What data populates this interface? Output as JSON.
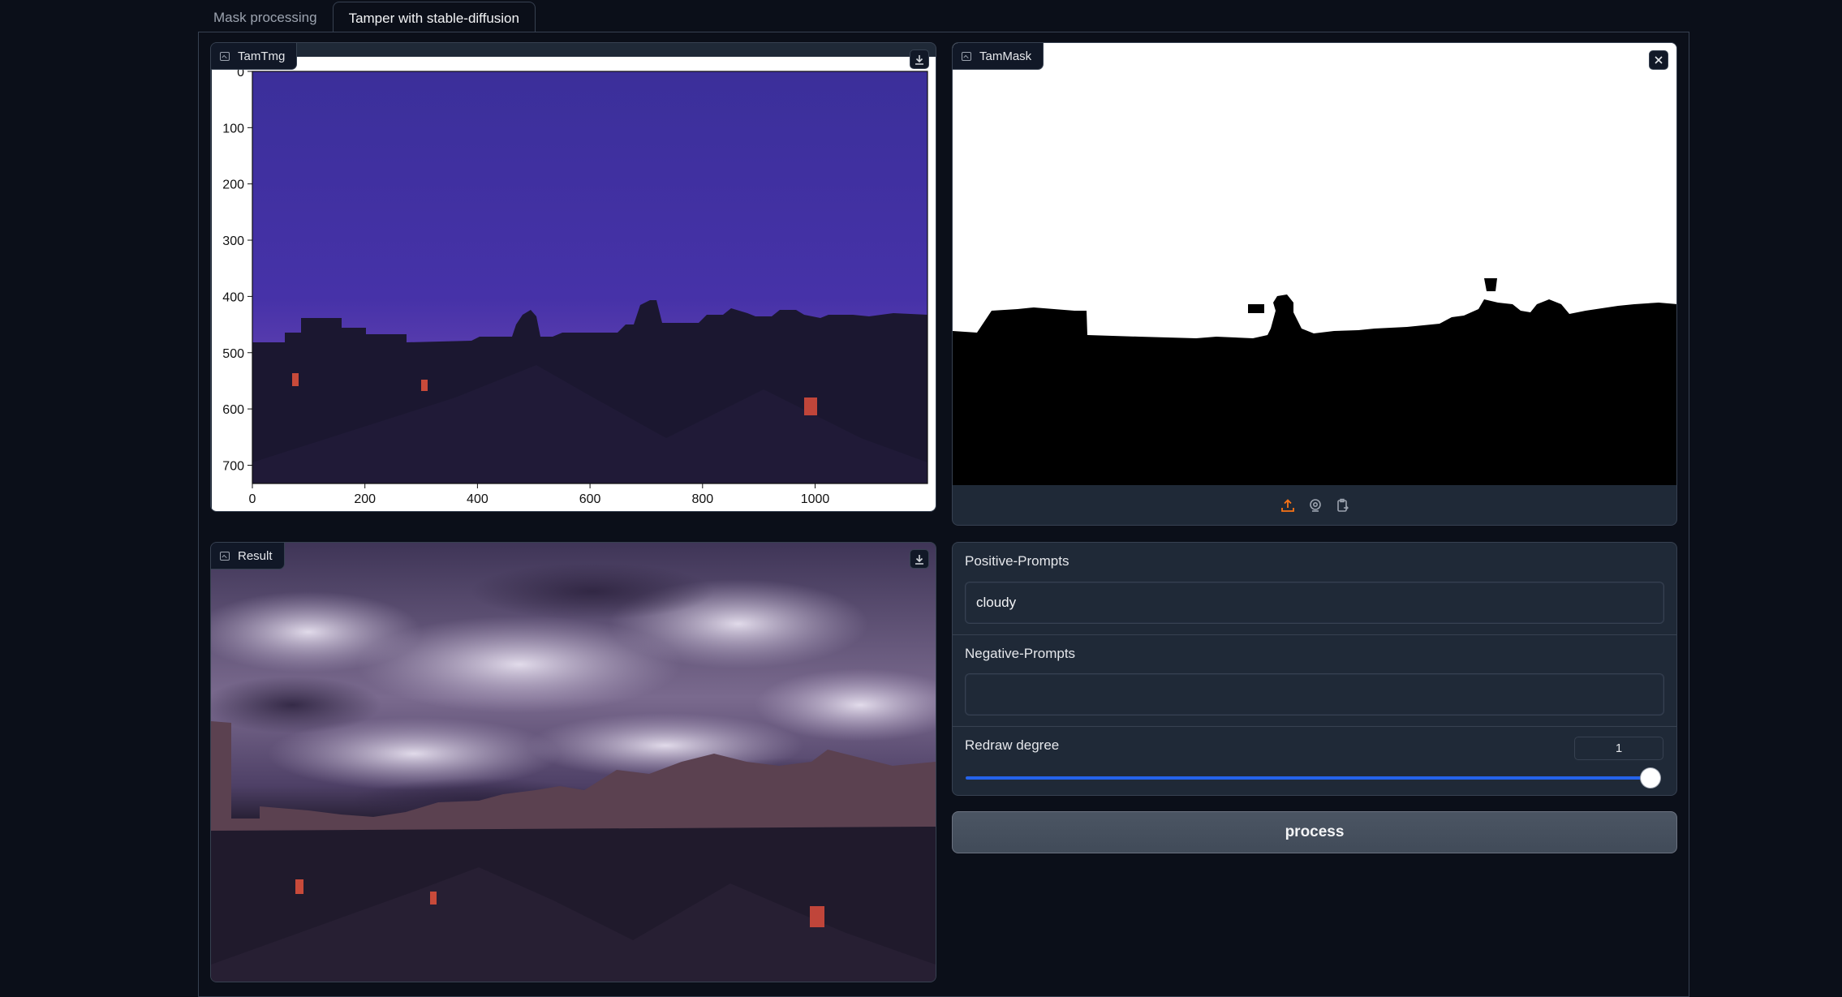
{
  "tabs": [
    {
      "label": "Mask processing",
      "active": false
    },
    {
      "label": "Tamper with stable-diffusion",
      "active": true
    }
  ],
  "tam_image": {
    "label": "TamTmg",
    "plot": {
      "x_ticks": [
        "0",
        "200",
        "400",
        "600",
        "800",
        "1000"
      ],
      "y_ticks": [
        "0",
        "100",
        "200",
        "300",
        "400",
        "500",
        "600",
        "700"
      ]
    }
  },
  "tam_mask": {
    "label": "TamMask",
    "toolbar": [
      "upload-icon",
      "webcam-icon",
      "clipboard-icon"
    ]
  },
  "result": {
    "label": "Result"
  },
  "form": {
    "positive_label": "Positive-Prompts",
    "positive_value": "cloudy",
    "negative_label": "Negative-Prompts",
    "negative_value": "",
    "redraw_label": "Redraw degree",
    "redraw_value": "1",
    "redraw_level": 1.0
  },
  "process_button": "process",
  "colors": {
    "background": "#0b0f19",
    "panel": "#1f2937",
    "border": "#374151",
    "slider_accent": "#2563eb",
    "upload_accent": "#f97316"
  }
}
